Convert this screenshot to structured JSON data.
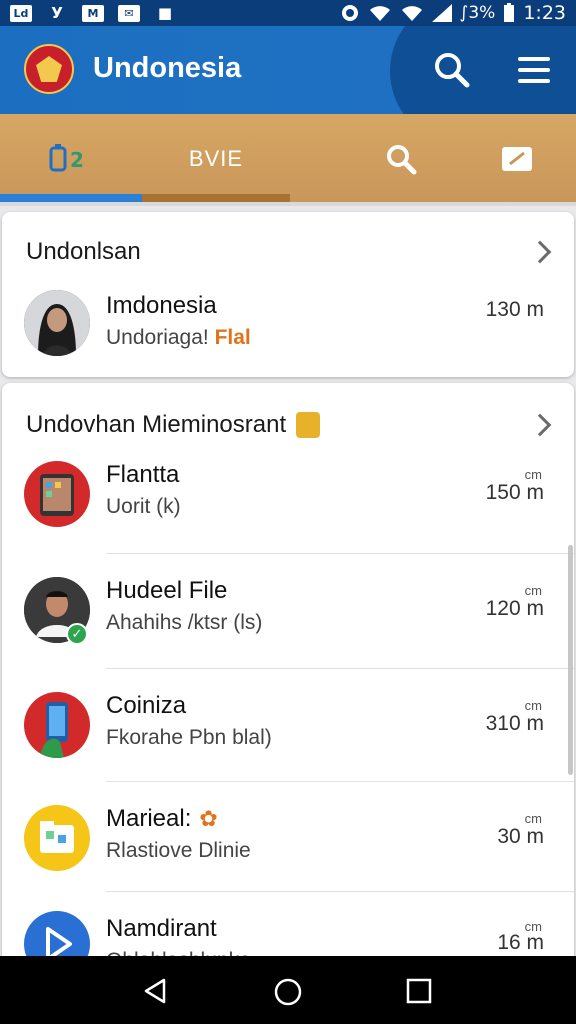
{
  "status_bar": {
    "left_icons": [
      "Ld",
      "У",
      "M",
      "✉",
      "■"
    ],
    "battery_text": "∫3%",
    "time": "1:23"
  },
  "app_bar": {
    "title": "Undonesia",
    "icons": [
      "search-icon",
      "menu-icon"
    ]
  },
  "tabs": [
    {
      "label": "",
      "icon": "phone-icon"
    },
    {
      "label": "BVIE"
    },
    {
      "label": "",
      "icon": "search-icon"
    },
    {
      "label": "",
      "icon": "edit-icon"
    }
  ],
  "section1": {
    "header": "Undonlsan",
    "item": {
      "title": "Imdonesia",
      "subtitle": "Undoriaga!",
      "badge": "Flal",
      "distance": "130 m"
    }
  },
  "section2": {
    "header": "Undovhan Mieminosrant",
    "items": [
      {
        "title": "Flantta",
        "subtitle": "Uorit (k)",
        "unit": "cm",
        "distance": "150 m",
        "avatar": "tablet"
      },
      {
        "title": "Hudeel File",
        "subtitle": "Ahahihs /ktsr (ls)",
        "unit": "cm",
        "distance": "120 m",
        "avatar": "person-male"
      },
      {
        "title": "Coiniza",
        "subtitle": "Fkorahe Pbn blal)",
        "unit": "cm",
        "distance": "310 m",
        "avatar": "phone"
      },
      {
        "title": "Marieal:",
        "subtitle": "Rlastiove Dlinie",
        "unit": "cm",
        "distance": "30 m",
        "avatar": "folder"
      },
      {
        "title": "Namdirant",
        "subtitle": "Qblahlashlunko",
        "unit": "cm",
        "distance": "16 m",
        "avatar": "play"
      }
    ]
  },
  "colors": {
    "app_bar": "#1c6fc0",
    "tab_bar": "#cf9e5f",
    "accent_orange": "#e2731b"
  }
}
